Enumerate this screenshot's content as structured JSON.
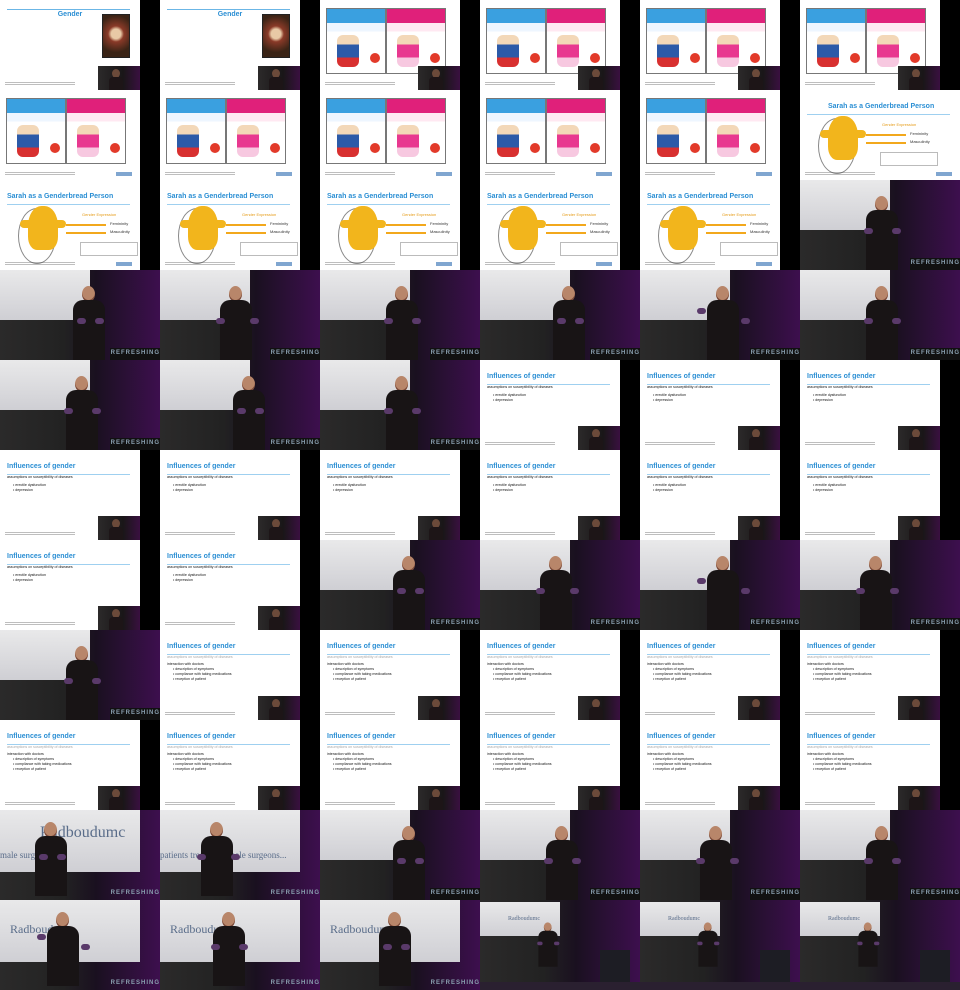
{
  "grid": {
    "columns": 6,
    "rows": 11
  },
  "texts": {
    "gender": "Gender",
    "genderbread": "Sarah as a Genderbread Person",
    "gender_expression": "Gender Expression",
    "femininity": "Femininity",
    "masculinity": "Masculinity",
    "influences": "Influences of gender",
    "assumptions": "assumptions on susceptibility of diseases",
    "b1": "erectile dysfunction",
    "b2": "depression",
    "c1": "interaction with doctors",
    "c2": "description of symptoms",
    "c3": "compliance with taking medications",
    "c4": "reception of patient",
    "refreshing": "REFRESHING",
    "radboud": "Radboudumc",
    "male_surgeons": "male surgeons...",
    "patients_treated": "patients treated by male surgeons..."
  },
  "cells": [
    {
      "kind": "slide-gender",
      "pip": true
    },
    {
      "kind": "slide-gender",
      "pip": true
    },
    {
      "kind": "slide-books",
      "pip": true
    },
    {
      "kind": "slide-books",
      "pip": true
    },
    {
      "kind": "slide-books",
      "pip": true
    },
    {
      "kind": "slide-books",
      "pip": true
    },
    {
      "kind": "slide-books",
      "pip": false
    },
    {
      "kind": "slide-books",
      "pip": false
    },
    {
      "kind": "slide-books",
      "pip": false
    },
    {
      "kind": "slide-books",
      "pip": false
    },
    {
      "kind": "slide-books",
      "pip": false
    },
    {
      "kind": "slide-genderbread-small",
      "pip": false
    },
    {
      "kind": "slide-genderbread",
      "pip": false
    },
    {
      "kind": "slide-genderbread",
      "pip": false
    },
    {
      "kind": "slide-genderbread",
      "pip": false
    },
    {
      "kind": "slide-genderbread",
      "pip": false
    },
    {
      "kind": "slide-genderbread",
      "pip": false
    },
    {
      "kind": "speaker",
      "pose": 1
    },
    {
      "kind": "speaker",
      "pose": 2
    },
    {
      "kind": "speaker",
      "pose": 3
    },
    {
      "kind": "speaker",
      "pose": 1
    },
    {
      "kind": "speaker",
      "pose": 2
    },
    {
      "kind": "speaker",
      "pose": 4
    },
    {
      "kind": "speaker",
      "pose": 1
    },
    {
      "kind": "speaker",
      "pose": 1
    },
    {
      "kind": "speaker",
      "pose": 2
    },
    {
      "kind": "speaker",
      "pose": 1
    },
    {
      "kind": "slide-influences-a",
      "pip": true
    },
    {
      "kind": "slide-influences-a",
      "pip": true
    },
    {
      "kind": "slide-influences-a",
      "pip": true
    },
    {
      "kind": "slide-influences-a",
      "pip": true
    },
    {
      "kind": "slide-influences-a",
      "pip": true
    },
    {
      "kind": "slide-influences-a",
      "pip": true
    },
    {
      "kind": "slide-influences-a",
      "pip": true
    },
    {
      "kind": "slide-influences-a",
      "pip": true
    },
    {
      "kind": "slide-influences-a",
      "pip": true
    },
    {
      "kind": "slide-influences-a",
      "pip": true
    },
    {
      "kind": "slide-influences-a",
      "pip": true
    },
    {
      "kind": "speaker",
      "pose": 2
    },
    {
      "kind": "speaker",
      "pose": 3
    },
    {
      "kind": "speaker",
      "pose": 4
    },
    {
      "kind": "speaker",
      "pose": 3
    },
    {
      "kind": "speaker",
      "pose": 1
    },
    {
      "kind": "slide-influences-b",
      "pip": true
    },
    {
      "kind": "slide-influences-b",
      "pip": true
    },
    {
      "kind": "slide-influences-b",
      "pip": true
    },
    {
      "kind": "slide-influences-b",
      "pip": true
    },
    {
      "kind": "slide-influences-b",
      "pip": true
    },
    {
      "kind": "slide-influences-b",
      "pip": true
    },
    {
      "kind": "slide-influences-b",
      "pip": true
    },
    {
      "kind": "slide-influences-b",
      "pip": true
    },
    {
      "kind": "slide-influences-b",
      "pip": true
    },
    {
      "kind": "slide-influences-b",
      "pip": true
    },
    {
      "kind": "slide-influences-b",
      "pip": true
    },
    {
      "kind": "speaker-radboud",
      "variant": 1
    },
    {
      "kind": "speaker-radboud",
      "variant": 2
    },
    {
      "kind": "speaker",
      "pose": 2
    },
    {
      "kind": "speaker",
      "pose": 1
    },
    {
      "kind": "speaker",
      "pose": 3
    },
    {
      "kind": "speaker",
      "pose": 1
    },
    {
      "kind": "speaker-radboud",
      "variant": 3
    },
    {
      "kind": "speaker-radboud",
      "variant": 4
    },
    {
      "kind": "speaker-radboud",
      "variant": 5
    },
    {
      "kind": "stage-wide",
      "variant": 1
    },
    {
      "kind": "stage-wide",
      "variant": 2
    },
    {
      "kind": "stage-wide",
      "variant": 3
    }
  ]
}
